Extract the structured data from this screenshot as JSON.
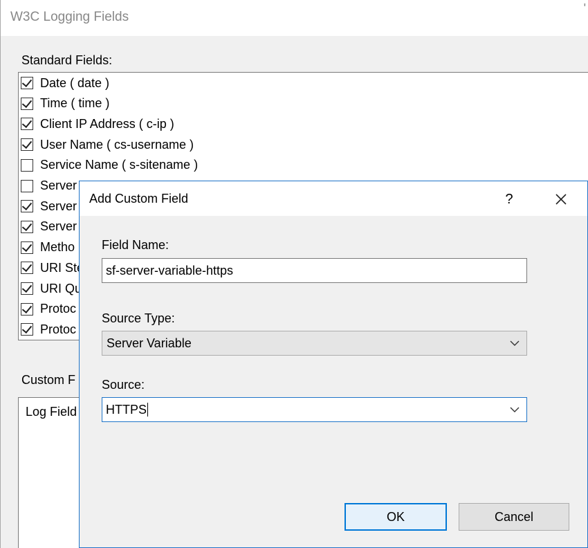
{
  "back_window": {
    "title": "W3C Logging Fields",
    "close_fragment": "'",
    "standard_fields_label": "Standard Fields:",
    "fields": [
      {
        "label": "Date ( date )",
        "checked": true
      },
      {
        "label": "Time ( time )",
        "checked": true
      },
      {
        "label": "Client IP Address ( c-ip )",
        "checked": true
      },
      {
        "label": "User Name ( cs-username )",
        "checked": true
      },
      {
        "label": "Service Name ( s-sitename )",
        "checked": false
      },
      {
        "label": "Server",
        "checked": false
      },
      {
        "label": "Server",
        "checked": true
      },
      {
        "label": "Server",
        "checked": true
      },
      {
        "label": "Metho",
        "checked": true
      },
      {
        "label": "URI Ste",
        "checked": true
      },
      {
        "label": "URI Qu",
        "checked": true
      },
      {
        "label": "Protoc",
        "checked": true
      },
      {
        "label": "Protoc",
        "checked": true
      }
    ],
    "custom_fields_label": "Custom F",
    "custom_column_header": "Log Field"
  },
  "dialog": {
    "title": "Add Custom Field",
    "help_glyph": "?",
    "field_name_label": "Field Name:",
    "field_name_value": "sf-server-variable-https",
    "source_type_label": "Source Type:",
    "source_type_value": "Server Variable",
    "source_label": "Source:",
    "source_value": "HTTPS",
    "ok_label": "OK",
    "cancel_label": "Cancel"
  },
  "colors": {
    "accent": "#0078d7",
    "dialog_border": "#1e74c8",
    "window_bg": "#f0f0f0"
  },
  "icons": {
    "close": "close-icon",
    "chevron": "chevron-down-icon",
    "checkbox": "check-icon"
  }
}
